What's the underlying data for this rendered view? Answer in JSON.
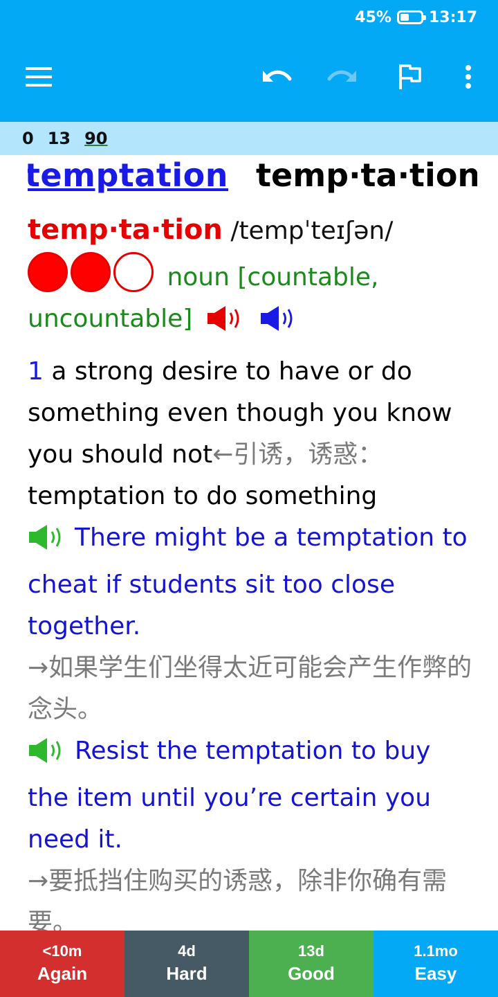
{
  "status_bar": {
    "battery": "45%",
    "time": "13:17"
  },
  "toolbar": {
    "menu_icon": "hamburger-menu-icon",
    "undo_icon": "undo-icon",
    "redo_icon": "redo-icon",
    "flag_icon": "flag-icon",
    "more_icon": "more-vert-icon"
  },
  "counts": {
    "new": "0",
    "learning": "13",
    "review": "90"
  },
  "card": {
    "headword_link": "temptation",
    "headword_syllables": "temp·ta·tion",
    "entry_headword": "temp·ta·tion",
    "pronunciation": "/tempˈteɪʃən/",
    "frequency_filled": 2,
    "frequency_total": 3,
    "part_of_speech": "noun [countable, uncountable]",
    "speaker_colors": [
      "#e60000",
      "#1a1ae6"
    ],
    "sense": {
      "number": "1",
      "definition": "a strong desire to have or do something even though you know you should not",
      "definition_zh": "←引诱，诱惑：",
      "pattern": "temptation to do something",
      "examples": [
        {
          "text": "There might be a temptation to cheat if students sit too close together.",
          "translation": "→如果学生们坐得太近可能会产生作弊的念头。"
        },
        {
          "text": "Resist the temptation to buy the item until you’re certain you need it.",
          "translation": "→要抵挡住购买的诱惑，除非你确有需要。"
        }
      ]
    }
  },
  "answers": [
    {
      "interval": "<10m",
      "label": "Again"
    },
    {
      "interval": "4d",
      "label": "Hard"
    },
    {
      "interval": "13d",
      "label": "Good"
    },
    {
      "interval": "1.1mo",
      "label": "Easy"
    }
  ]
}
